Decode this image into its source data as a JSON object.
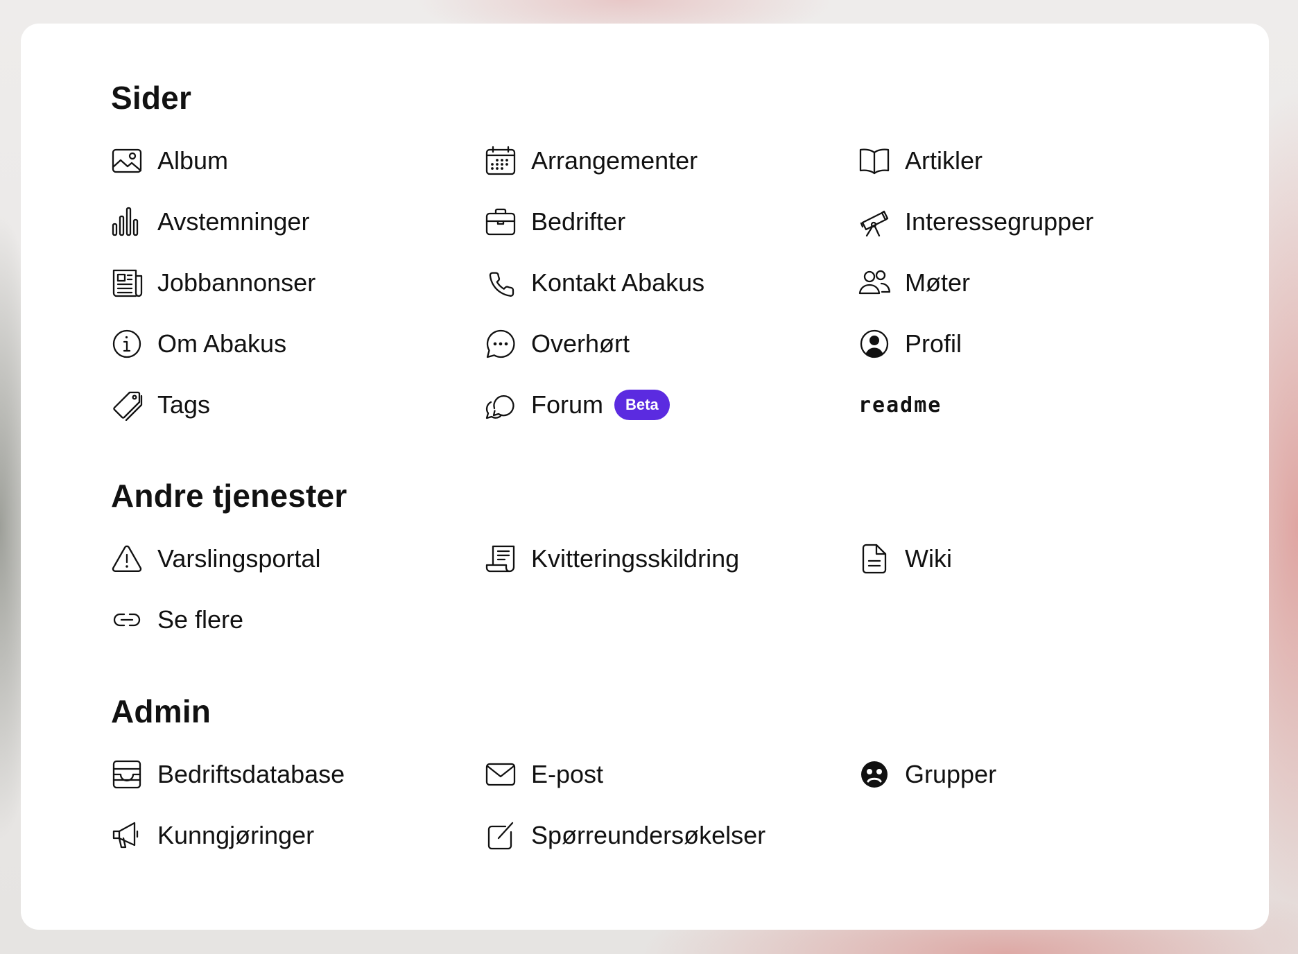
{
  "colors": {
    "badge_background": "#5b2be0",
    "badge_text": "#ffffff",
    "text": "#111111",
    "card": "#ffffff"
  },
  "sections": {
    "sider": {
      "title": "Sider",
      "items": [
        {
          "label": "Album",
          "icon": "image-icon"
        },
        {
          "label": "Arrangementer",
          "icon": "calendar-icon"
        },
        {
          "label": "Artikler",
          "icon": "book-icon"
        },
        {
          "label": "Avstemninger",
          "icon": "bar-chart-icon"
        },
        {
          "label": "Bedrifter",
          "icon": "briefcase-icon"
        },
        {
          "label": "Interessegrupper",
          "icon": "telescope-icon"
        },
        {
          "label": "Jobbannonser",
          "icon": "newspaper-icon"
        },
        {
          "label": "Kontakt Abakus",
          "icon": "phone-icon"
        },
        {
          "label": "Møter",
          "icon": "people-icon"
        },
        {
          "label": "Om Abakus",
          "icon": "info-icon"
        },
        {
          "label": "Overhørt",
          "icon": "chat-bubble-dots-icon"
        },
        {
          "label": "Profil",
          "icon": "user-circle-icon"
        },
        {
          "label": "Tags",
          "icon": "pricetags-icon"
        },
        {
          "label": "Forum",
          "icon": "chat-bubbles-icon",
          "badge": "Beta"
        },
        {
          "label": "readme"
        }
      ]
    },
    "andre_tjenester": {
      "title": "Andre tjenester",
      "items": [
        {
          "label": "Varslingsportal",
          "icon": "warning-icon"
        },
        {
          "label": "Kvitteringsskildring",
          "icon": "receipt-icon"
        },
        {
          "label": "Wiki",
          "icon": "document-icon"
        },
        {
          "label": "Se flere",
          "icon": "link-icon"
        }
      ]
    },
    "admin": {
      "title": "Admin",
      "items": [
        {
          "label": "Bedriftsdatabase",
          "icon": "archive-icon"
        },
        {
          "label": "E-post",
          "icon": "mail-icon"
        },
        {
          "label": "Grupper",
          "icon": "sad-face-icon"
        },
        {
          "label": "Kunngjøringer",
          "icon": "megaphone-icon"
        },
        {
          "label": "Spørreundersøkelser",
          "icon": "create-icon"
        }
      ]
    }
  }
}
